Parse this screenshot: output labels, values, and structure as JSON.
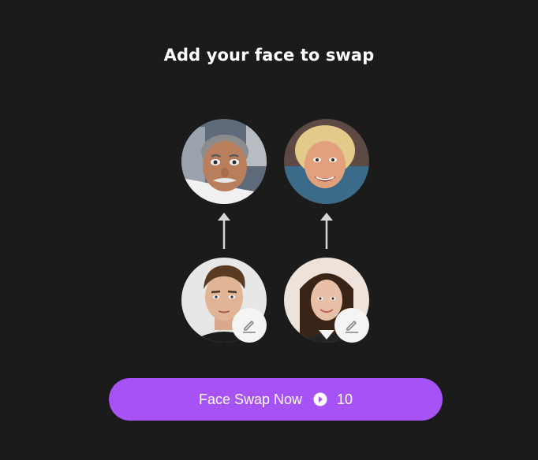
{
  "heading": "Add your face to swap",
  "faces": {
    "targets": [
      {
        "name": "target-face-1",
        "description_icon": "older-man-portrait"
      },
      {
        "name": "target-face-2",
        "description_icon": "older-woman-portrait"
      }
    ],
    "sources": [
      {
        "name": "source-face-1",
        "description_icon": "young-man-portrait"
      },
      {
        "name": "source-face-2",
        "description_icon": "young-woman-portrait"
      }
    ]
  },
  "icons": {
    "edit": "pencil-icon",
    "arrow": "arrow-up-icon",
    "coin": "coin-icon"
  },
  "action_button": {
    "label": "Face Swap Now",
    "credits": "10"
  },
  "colors": {
    "background": "#1b1b1b",
    "accent": "#a652f5",
    "edit_button": "#f4f4f4"
  }
}
